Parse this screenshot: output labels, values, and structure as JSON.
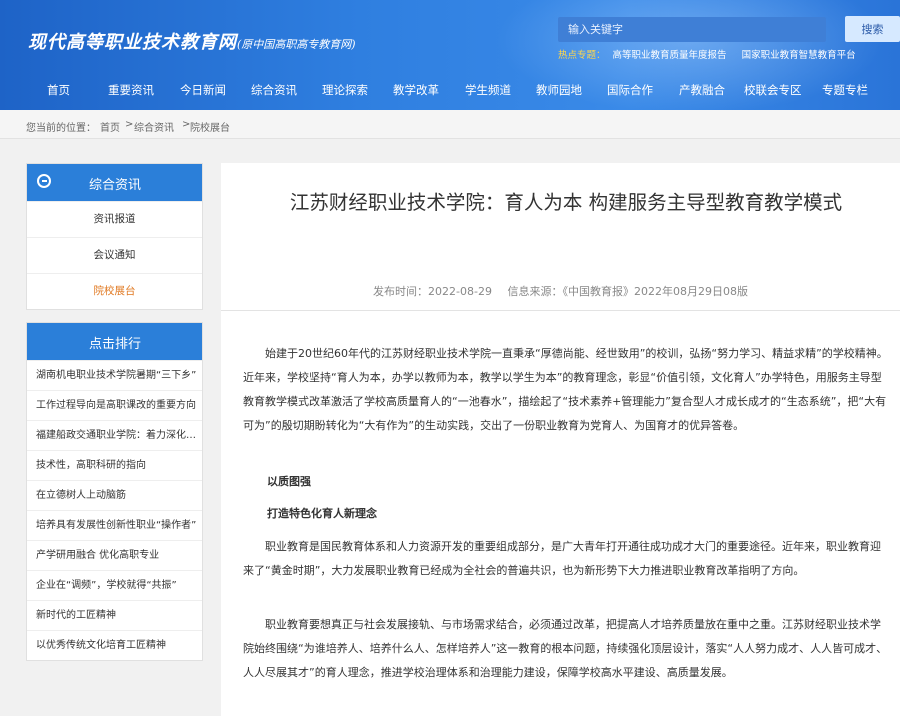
{
  "header": {
    "logo_text": "现代高等职业技术教育网",
    "logo_sub": "(原中国高职高专教育网)",
    "search_placeholder": "输入关键字",
    "search_button": "搜索",
    "hot_label": "热点专题：",
    "hot_links": [
      "高等职业教育质量年度报告",
      "国家职业教育智慧教育平台"
    ]
  },
  "nav": [
    "首页",
    "重要资讯",
    "今日新闻",
    "综合资讯",
    "理论探索",
    "教学改革",
    "学生频道",
    "教师园地",
    "国际合作",
    "产教融合",
    "校联会专区",
    "专题专栏"
  ],
  "breadcrumb": [
    "您当前的位置：",
    "首页",
    ">",
    "综合资讯",
    ">",
    "院校展台"
  ],
  "sidebar": {
    "section_title": "综合资讯",
    "items": [
      "资讯报道",
      "会议通知",
      "院校展台"
    ],
    "ranking_title": "点击排行",
    "ranking": [
      "湖南机电职业技术学院暑期“三下乡”",
      "工作过程导向是高职课改的重要方向",
      "福建船政交通职业学院：着力深化产教融合",
      "技术性，高职科研的指向",
      "在立德树人上动脑筋",
      "培养具有发展性创新性职业“操作者”",
      "产学研用融合 优化高职专业",
      "企业在“调频”，学校就得“共振”",
      "新时代的工匠精神",
      "以优秀传统文化培育工匠精神"
    ]
  },
  "article": {
    "title": "江苏财经职业技术学院：育人为本 构建服务主导型教育教学模式",
    "date_label": "发布时间：2022-08-29",
    "source_label": "信息来源：《中国教育报》2022年08月29日08版",
    "p1": "始建于20世纪60年代的江苏财经职业技术学院一直秉承“厚德尚能、经世致用”的校训，弘扬“努力学习、精益求精”的学校精神。近年来，学校坚持“育人为本，办学以教师为本，教学以学生为本”的教育理念，彰显“价值引领，文化育人”办学特色，用服务主导型教育教学模式改革激活了学校高质量育人的“一池春水”，描绘起了“技术素养+管理能力”复合型人才成长成才的“生态系统”，把“大有可为”的殷切期盼转化为“大有作为”的生动实践，交出了一份职业教育为党育人、为国育才的优异答卷。",
    "h1": "以质图强",
    "h2": "打造特色化育人新理念",
    "p2": "职业教育是国民教育体系和人力资源开发的重要组成部分，是广大青年打开通往成功成才大门的重要途径。近年来，职业教育迎来了“黄金时期”，大力发展职业教育已经成为全社会的普遍共识，也为新形势下大力推进职业教育改革指明了方向。",
    "p3": "职业教育要想真正与社会发展接轨、与市场需求结合，必须通过改革，把提高人才培养质量放在重中之重。江苏财经职业技术学院始终围绕“为谁培养人、培养什么人、怎样培养人”这一教育的根本问题，持续强化顶层设计，落实“人人努力成才、人人皆可成才、人人尽展其才”的育人理念，推进学校治理体系和治理能力建设，保障学校高水平建设、高质量发展。"
  },
  "colors": {
    "header_blue": "#2a74d8",
    "side_blue": "#2b7fd9",
    "active_orange": "#e07820",
    "hot_yellow": "#ffd74a"
  }
}
